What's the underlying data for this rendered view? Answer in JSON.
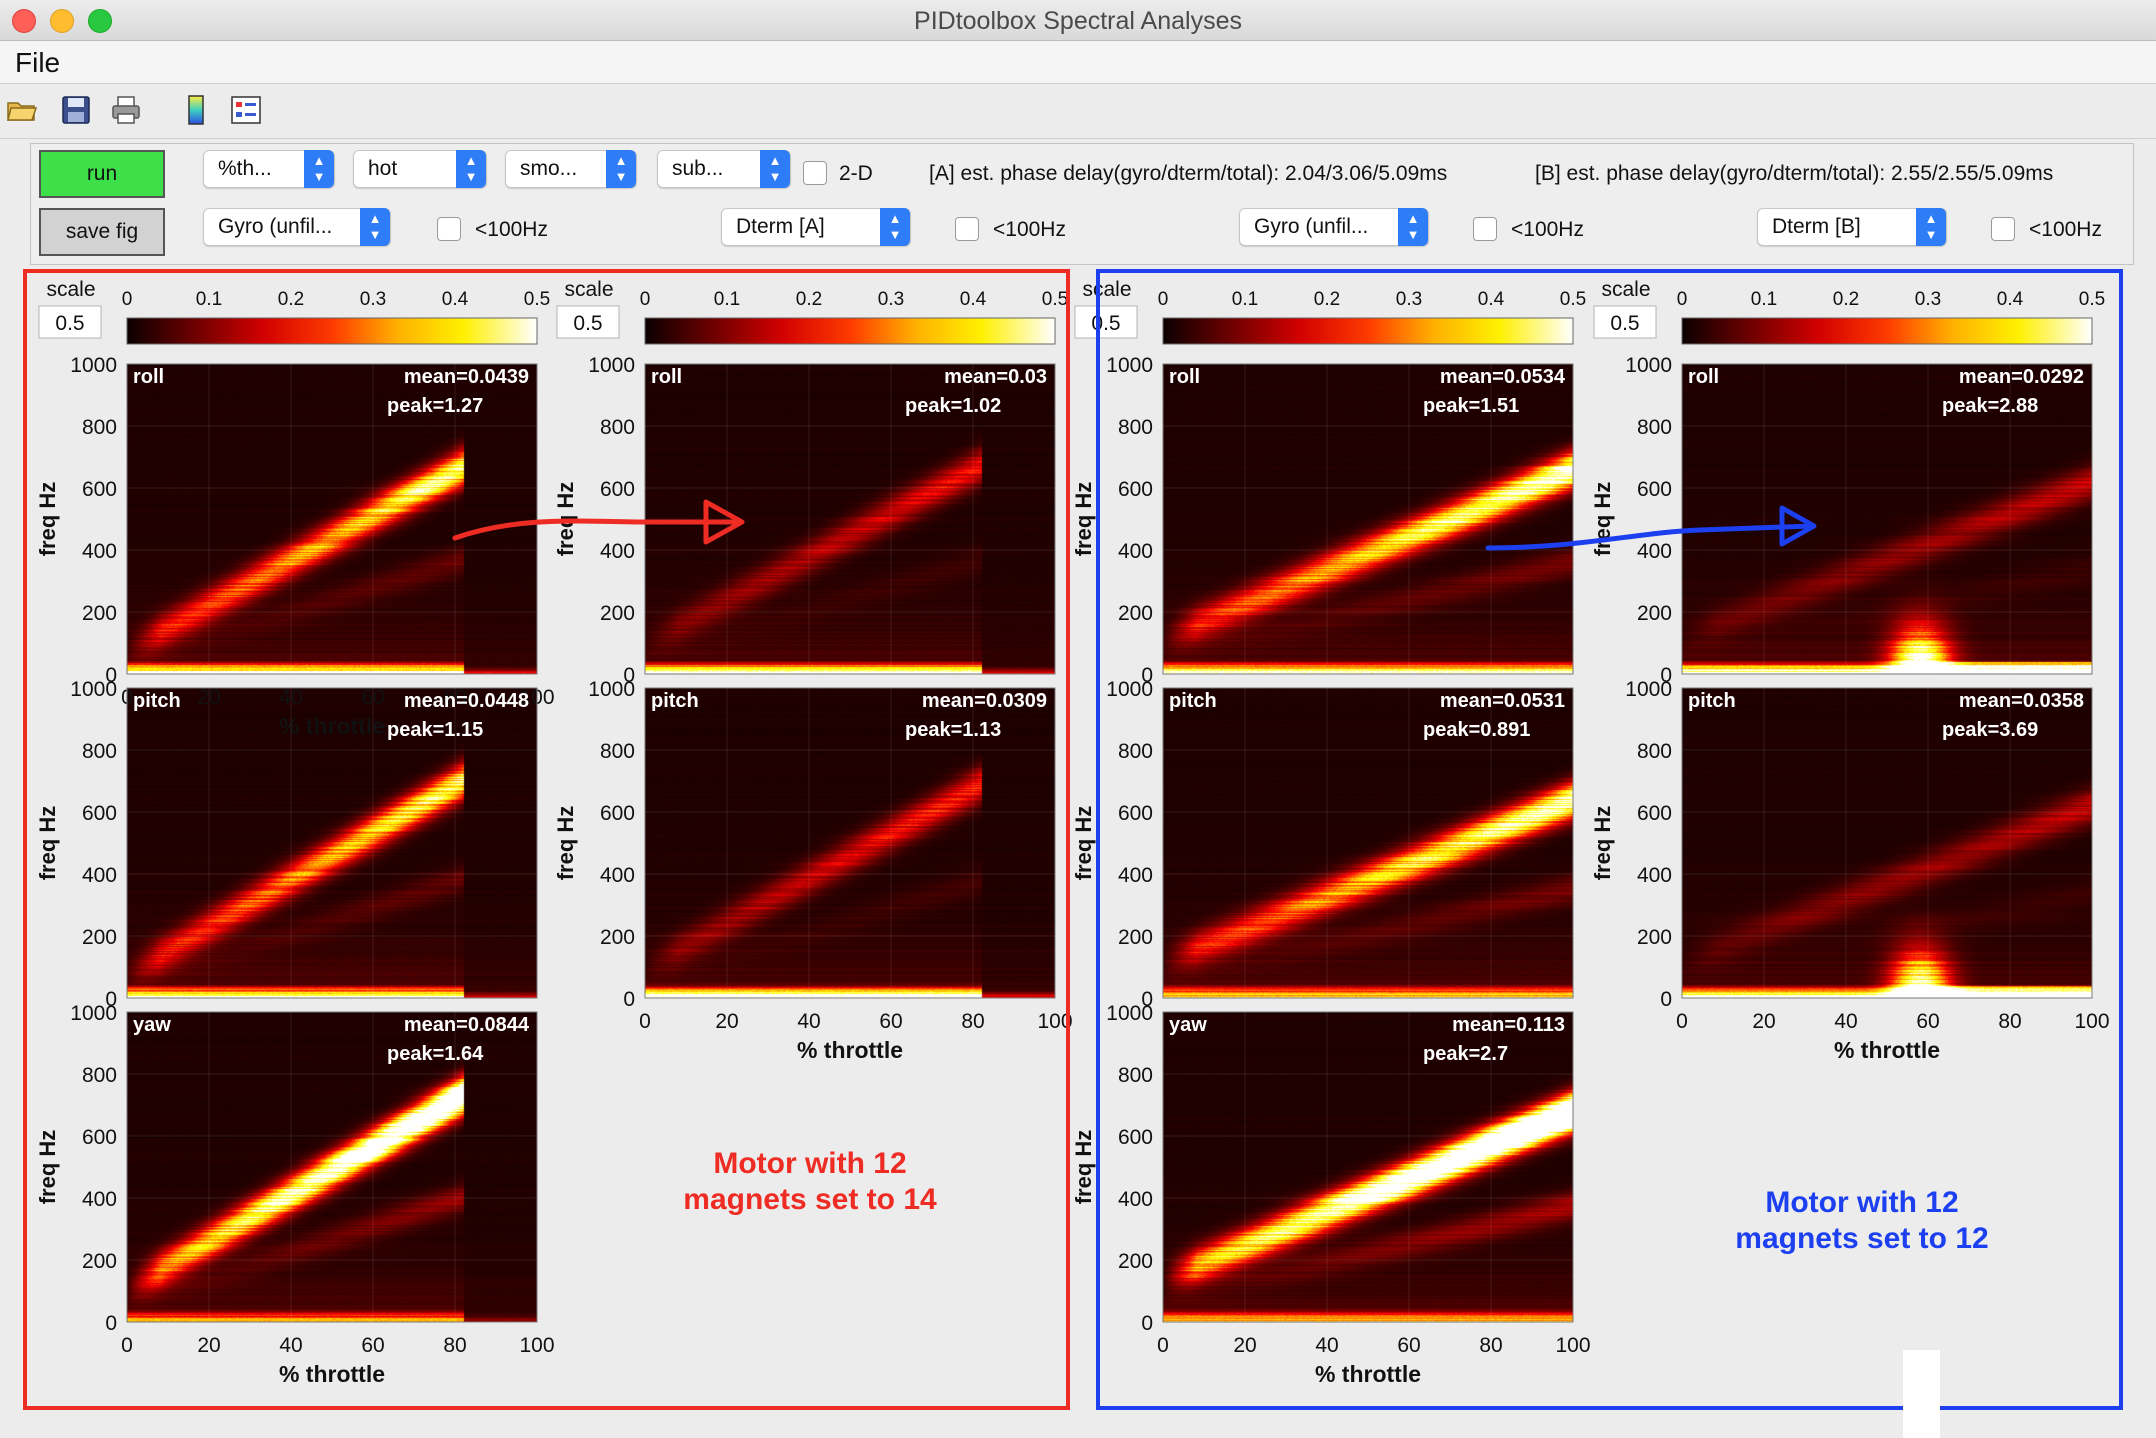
{
  "window": {
    "title": "PIDtoolbox Spectral Analyses"
  },
  "menu": {
    "file": "File"
  },
  "toolbar": {
    "icons": [
      "open-folder-icon",
      "save-icon",
      "print-icon",
      "colorbar-icon",
      "legend-icon"
    ]
  },
  "controls": {
    "run_label": "run",
    "save_label": "save fig",
    "dropdown_percent": "%th...",
    "dropdown_colormap": "hot",
    "dropdown_smooth": "smo...",
    "dropdown_sub": "sub...",
    "checkbox_2d": "2-D",
    "status_a": "[A] est. phase delay(gyro/dterm/total): 2.04/3.06/5.09ms",
    "status_b": "[B] est. phase delay(gyro/dterm/total): 2.55/2.55/5.09ms",
    "columns": [
      {
        "dropdown": "Gyro (unfil...",
        "check_label": "<100Hz"
      },
      {
        "dropdown": "Dterm [A]",
        "check_label": "<100Hz"
      },
      {
        "dropdown": "Gyro (unfil...",
        "check_label": "<100Hz"
      },
      {
        "dropdown": "Dterm [B]",
        "check_label": "<100Hz"
      }
    ]
  },
  "colorbar": {
    "scale_label": "scale",
    "scale_value": "0.5",
    "ticks": [
      "0",
      "0.1",
      "0.2",
      "0.3",
      "0.4",
      "0.5"
    ]
  },
  "axes": {
    "ylabel": "freq Hz",
    "xlabel": "% throttle",
    "yticks": [
      "1000",
      "800",
      "600",
      "400",
      "200",
      "0"
    ],
    "xticks": [
      "0",
      "20",
      "40",
      "60",
      "80",
      "100"
    ]
  },
  "panels": [
    {
      "id": "A-gyro-roll",
      "axis": "roll",
      "mean": "mean=0.0439",
      "peak": "peak=1.27"
    },
    {
      "id": "A-gyro-pitch",
      "axis": "pitch",
      "mean": "mean=0.0448",
      "peak": "peak=1.15"
    },
    {
      "id": "A-gyro-yaw",
      "axis": "yaw",
      "mean": "mean=0.0844",
      "peak": "peak=1.64"
    },
    {
      "id": "A-dterm-roll",
      "axis": "roll",
      "mean": "mean=0.03",
      "peak": "peak=1.02"
    },
    {
      "id": "A-dterm-pitch",
      "axis": "pitch",
      "mean": "mean=0.0309",
      "peak": "peak=1.13"
    },
    {
      "id": "B-gyro-roll",
      "axis": "roll",
      "mean": "mean=0.0534",
      "peak": "peak=1.51"
    },
    {
      "id": "B-gyro-pitch",
      "axis": "pitch",
      "mean": "mean=0.0531",
      "peak": "peak=0.891"
    },
    {
      "id": "B-gyro-yaw",
      "axis": "yaw",
      "mean": "mean=0.113",
      "peak": "peak=2.7"
    },
    {
      "id": "B-dterm-roll",
      "axis": "roll",
      "mean": "mean=0.0292",
      "peak": "peak=2.88"
    },
    {
      "id": "B-dterm-pitch",
      "axis": "pitch",
      "mean": "mean=0.0358",
      "peak": "peak=3.69"
    }
  ],
  "annotations": {
    "red_text": [
      "Motor with 12",
      "magnets set to 14"
    ],
    "blue_text": [
      "Motor with 12",
      "magnets set to 12"
    ],
    "red_color": "#ef2c23",
    "blue_color": "#1c3ff0"
  },
  "colors": {
    "run_button": "#3ee04a",
    "popup_arrow": "#2f7df6"
  }
}
